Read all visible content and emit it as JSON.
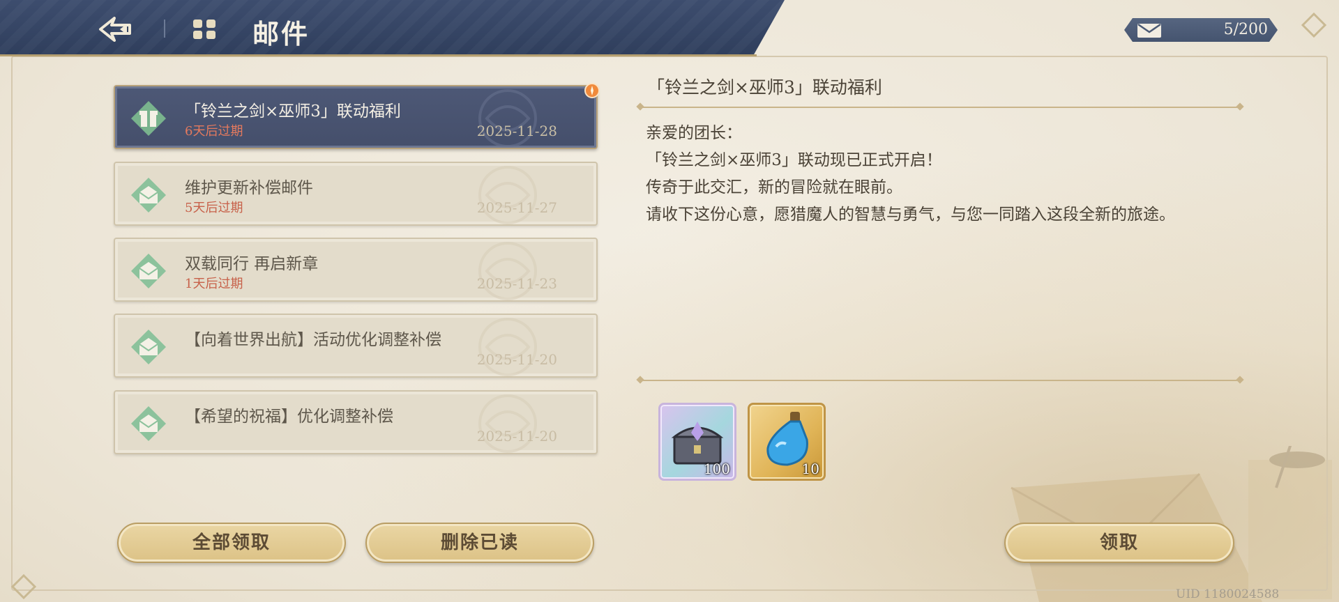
{
  "header": {
    "title": "邮件",
    "back_icon": "back-arrow-icon",
    "mail_icon": "mail-grid-icon"
  },
  "mail_count": {
    "text": "5/200",
    "icon": "envelope-icon"
  },
  "mails": [
    {
      "title": "「铃兰之剑×巫师3」联动福利",
      "expiry": "6天后过期",
      "date": "2025-11-28",
      "selected": true,
      "icon": "gift-icon"
    },
    {
      "title": "维护更新补偿邮件",
      "expiry": "5天后过期",
      "date": "2025-11-27",
      "selected": false,
      "icon": "opened-letter-icon"
    },
    {
      "title": "双载同行 再启新章",
      "expiry": "1天后过期",
      "date": "2025-11-23",
      "selected": false,
      "icon": "opened-letter-icon"
    },
    {
      "title": "【向着世界出航】活动优化调整补偿",
      "expiry": "",
      "date": "2025-11-20",
      "selected": false,
      "icon": "opened-letter-icon"
    },
    {
      "title": "【希望的祝福】优化调整补偿",
      "expiry": "",
      "date": "2025-11-20",
      "selected": false,
      "icon": "opened-letter-icon"
    }
  ],
  "buttons": {
    "claim_all": "全部领取",
    "delete_read": "删除已读",
    "claim": "领取"
  },
  "detail": {
    "title": "「铃兰之剑×巫师3」联动福利",
    "body": [
      "亲爱的团长：",
      "「铃兰之剑×巫师3」联动现已正式开启！",
      "传奇于此交汇，新的冒险就在眼前。",
      "请收下这份心意，愿猎魔人的智慧与勇气，与您一同踏入这段全新的旅途。"
    ],
    "rewards": [
      {
        "icon": "treasure-chest-icon",
        "count": "100"
      },
      {
        "icon": "blue-potion-icon",
        "count": "10"
      }
    ]
  },
  "uid": "UID 1180024588",
  "colors": {
    "header": "#3d4d6e",
    "selected_item": "#4d5876",
    "button": "#dcc286",
    "expiry": "#c7614a"
  }
}
